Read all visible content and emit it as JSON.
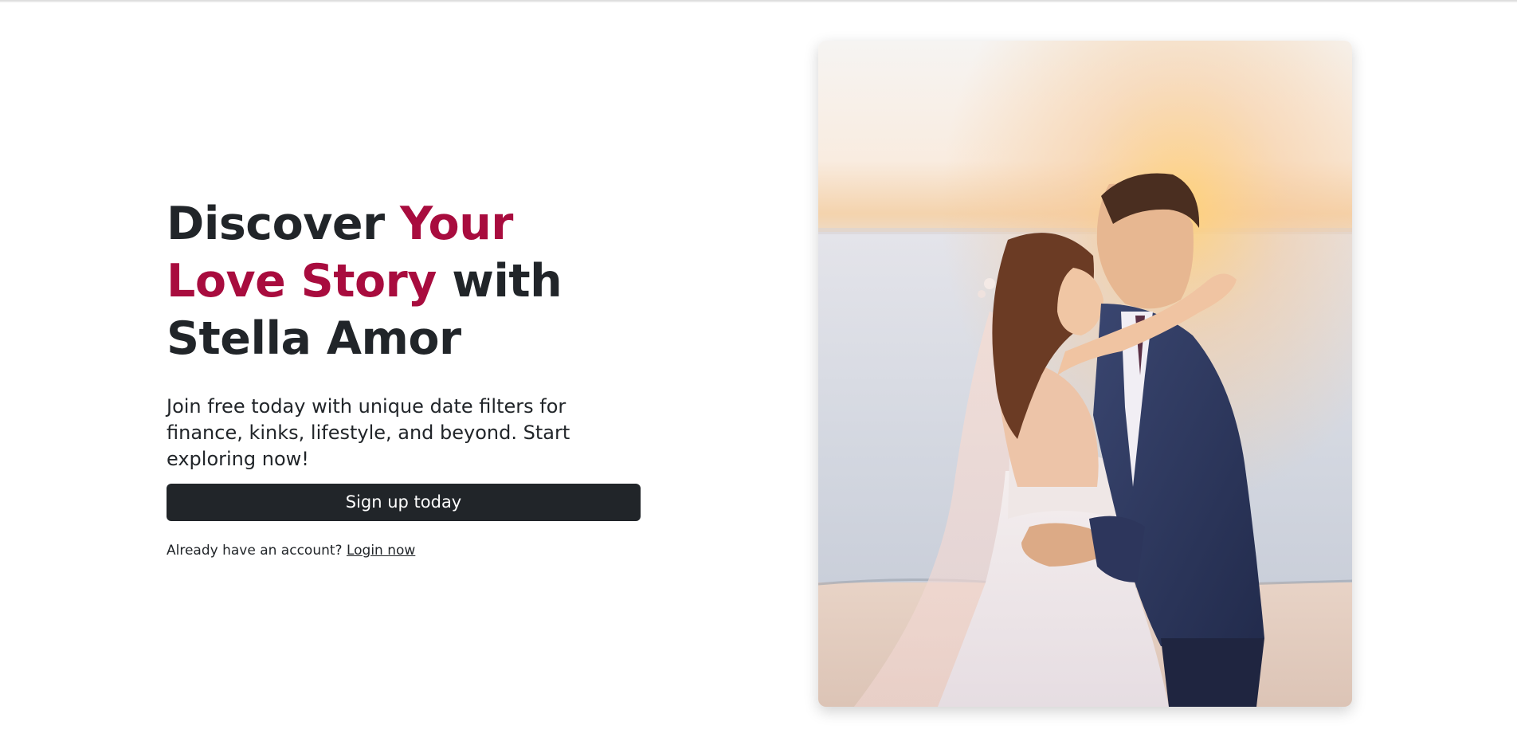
{
  "hero": {
    "headline_part1": "Discover ",
    "headline_accent": "Your Love Story",
    "headline_part2": " with Stella Amor",
    "subtitle": "Join free today with unique date filters for finance, kinks, lifestyle, and beyond. Start exploring now!",
    "signup_label": "Sign up today",
    "login_prompt": "Already have an account?",
    "login_link": "Login now"
  },
  "photo": {
    "icon": "wedding-couple-photo"
  },
  "colors": {
    "accent": "#a80c3e",
    "dark": "#212529",
    "background": "#ffffff"
  }
}
